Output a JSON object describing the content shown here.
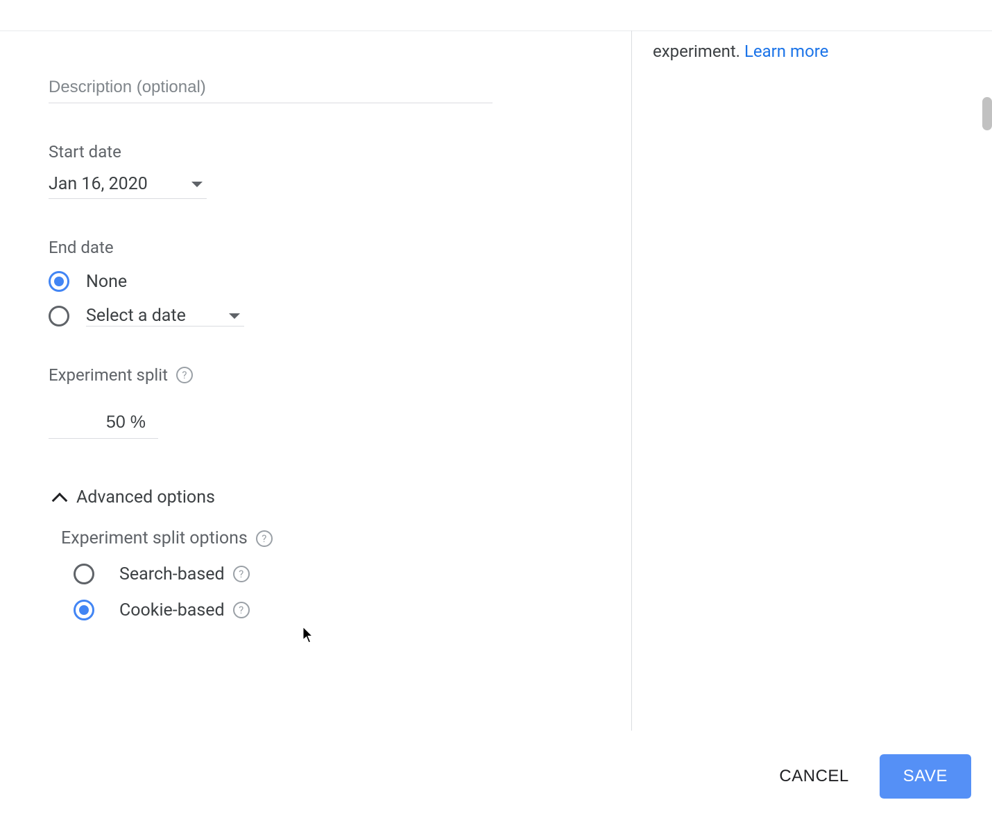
{
  "rightPanel": {
    "trailingText": "experiment.",
    "learnMore": "Learn more"
  },
  "description": {
    "placeholder": "Description (optional)"
  },
  "startDate": {
    "label": "Start date",
    "value": "Jan 16, 2020"
  },
  "endDate": {
    "label": "End date",
    "options": {
      "none": "None",
      "selectDate": "Select a date"
    },
    "selected": "none"
  },
  "experimentSplit": {
    "label": "Experiment split",
    "value": "50 %"
  },
  "advanced": {
    "toggleLabel": "Advanced options",
    "splitOptions": {
      "label": "Experiment split options",
      "searchBased": "Search-based",
      "cookieBased": "Cookie-based",
      "selected": "cookieBased"
    }
  },
  "footer": {
    "cancel": "CANCEL",
    "save": "SAVE"
  },
  "helpGlyph": "?"
}
